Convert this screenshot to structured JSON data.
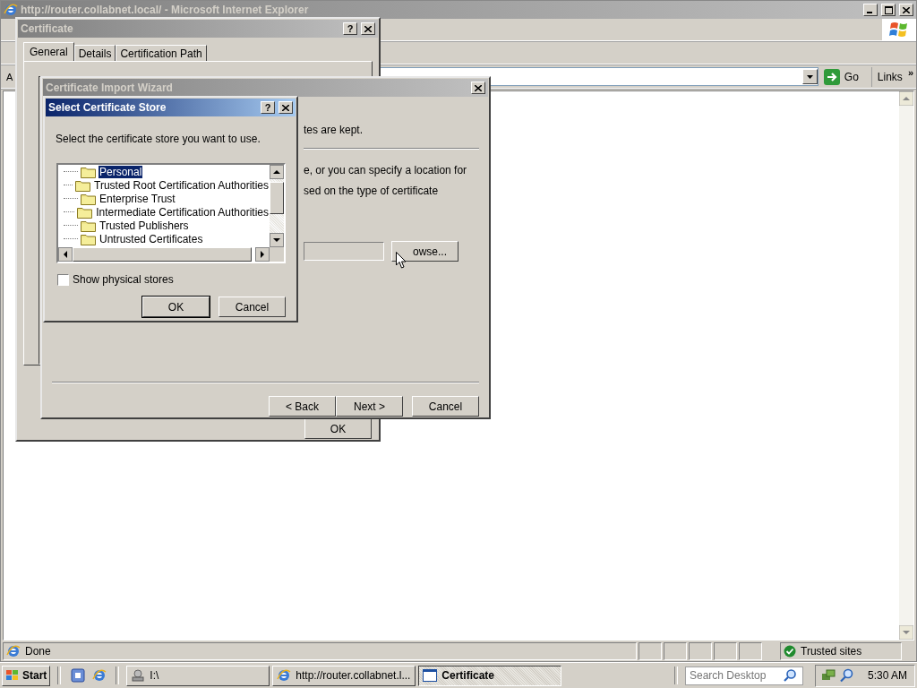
{
  "browser": {
    "title": "http://router.collabnet.local/ - Microsoft Internet Explorer",
    "active": false,
    "address_label": "A",
    "go_button": "Go",
    "links": "Links",
    "links_more": "»",
    "status_text": "Done",
    "zone": "Trusted sites"
  },
  "certificate_dialog": {
    "title": "Certificate",
    "active": false,
    "help_button": "?",
    "tabs": [
      {
        "label": "General",
        "selected": true
      },
      {
        "label": "Details",
        "selected": false
      },
      {
        "label": "Certification Path",
        "selected": false
      }
    ],
    "ok_button": "OK"
  },
  "import_wizard": {
    "title": "Certificate Import Wizard",
    "active": false,
    "intro_text": "tes are kept.",
    "option_lines": [
      "e, or you can specify a location for",
      "sed on the type of certificate"
    ],
    "browse_button": "owse...",
    "buttons": [
      {
        "label": "< Back"
      },
      {
        "label": "Next >"
      },
      {
        "label": "Cancel"
      }
    ]
  },
  "store_dialog": {
    "title": "Select Certificate Store",
    "active": true,
    "help_button": "?",
    "prompt": "Select the certificate store you want to use.",
    "stores": [
      {
        "label": "Personal",
        "selected": true
      },
      {
        "label": "Trusted Root Certification Authorities",
        "selected": false
      },
      {
        "label": "Enterprise Trust",
        "selected": false
      },
      {
        "label": "Intermediate Certification Authorities",
        "selected": false
      },
      {
        "label": "Trusted Publishers",
        "selected": false
      },
      {
        "label": "Untrusted Certificates",
        "selected": false
      }
    ],
    "show_physical": {
      "label": "Show physical stores",
      "checked": false
    },
    "buttons": [
      {
        "label": "OK",
        "default": true
      },
      {
        "label": "Cancel",
        "default": false
      }
    ]
  },
  "taskbar": {
    "start": "Start",
    "tasks": [
      {
        "label": "I:\\",
        "kind": "drive",
        "selected": false
      },
      {
        "label": "http://router.collabnet.l...",
        "kind": "browser",
        "selected": false
      },
      {
        "label": "Certificate",
        "kind": "window",
        "selected": true
      }
    ],
    "search": {
      "placeholder": "Search Desktop"
    },
    "clock": "5:30 AM"
  }
}
